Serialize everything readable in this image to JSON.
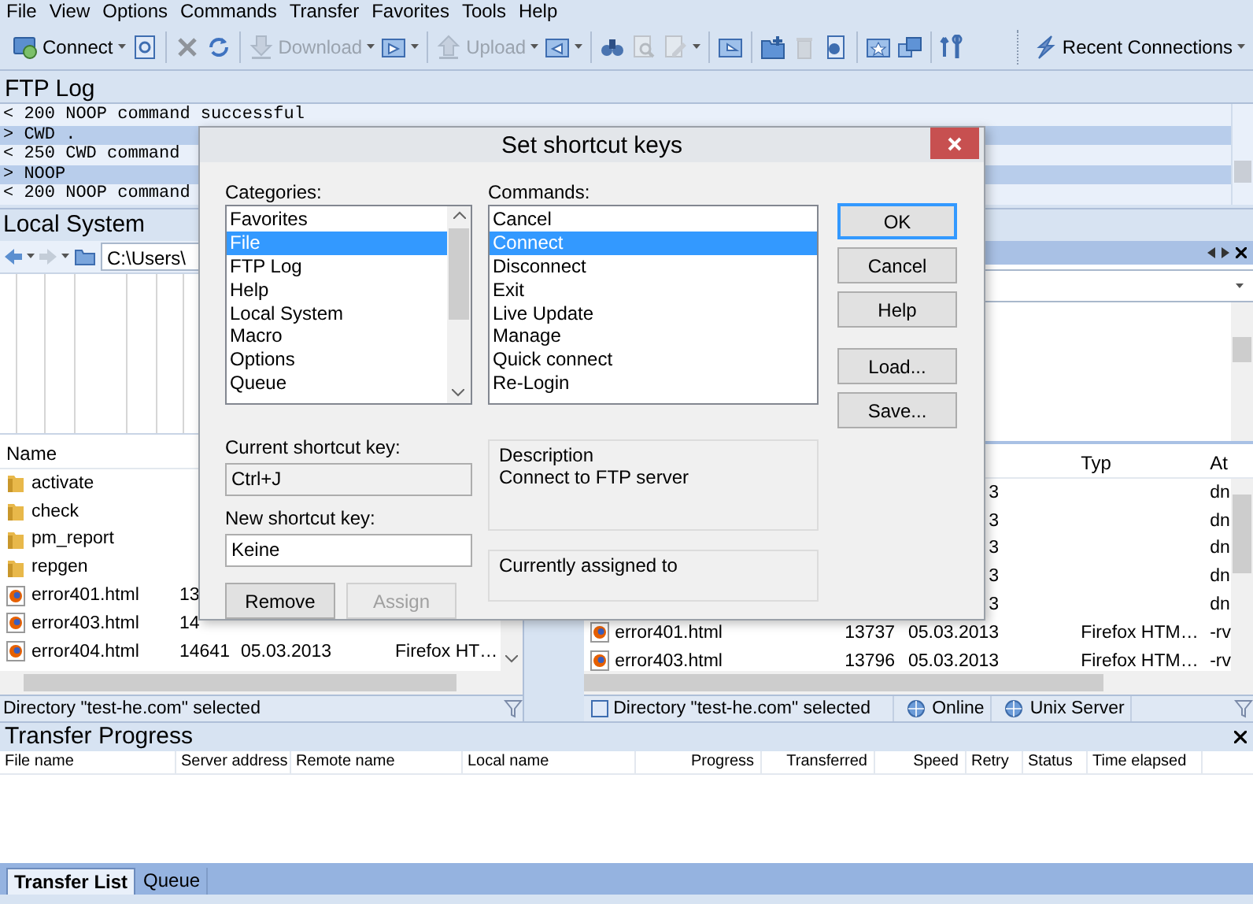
{
  "menu": [
    "File",
    "View",
    "Options",
    "Commands",
    "Transfer",
    "Favorites",
    "Tools",
    "Help"
  ],
  "toolbar": [
    {
      "kind": "labeled",
      "label": "Connect",
      "dropdown": true,
      "disabled": false
    },
    {
      "kind": "icon",
      "dropdown": false,
      "disabled": false
    },
    {
      "kind": "separator"
    },
    {
      "kind": "icon",
      "dropdown": false,
      "disabled": true
    },
    {
      "kind": "icon",
      "dropdown": false,
      "disabled": false
    },
    {
      "kind": "separator"
    },
    {
      "kind": "labeled",
      "label": "Download",
      "dropdown": true,
      "disabled": true
    },
    {
      "kind": "icon",
      "dropdown": true,
      "disabled": false
    },
    {
      "kind": "separator"
    },
    {
      "kind": "labeled",
      "label": "Upload",
      "dropdown": true,
      "disabled": true
    },
    {
      "kind": "icon",
      "dropdown": true,
      "disabled": false
    },
    {
      "kind": "separator"
    },
    {
      "kind": "icon",
      "dropdown": false,
      "disabled": false
    },
    {
      "kind": "icon",
      "dropdown": false,
      "disabled": true
    },
    {
      "kind": "icon",
      "dropdown": true,
      "disabled": true
    },
    {
      "kind": "separator"
    },
    {
      "kind": "icon",
      "dropdown": false,
      "disabled": false
    },
    {
      "kind": "separator"
    },
    {
      "kind": "icon",
      "dropdown": false,
      "disabled": false
    },
    {
      "kind": "icon",
      "dropdown": false,
      "disabled": true
    },
    {
      "kind": "icon",
      "dropdown": false,
      "disabled": false
    },
    {
      "kind": "separator"
    },
    {
      "kind": "icon",
      "dropdown": false,
      "disabled": false
    },
    {
      "kind": "icon",
      "dropdown": false,
      "disabled": false
    },
    {
      "kind": "separator"
    },
    {
      "kind": "icon",
      "dropdown": false,
      "disabled": false
    },
    {
      "kind": "separator"
    },
    {
      "kind": "labeled",
      "label": "Recent Connections",
      "dropdown": true,
      "disabled": false
    }
  ],
  "ftp_log": {
    "title": "FTP Log",
    "lines": [
      {
        "text": "< 200 NOOP command successful",
        "highlighted": false
      },
      {
        "text": "> CWD .",
        "highlighted": true
      },
      {
        "text": "< 250 CWD command",
        "highlighted": false
      },
      {
        "text": "> NOOP",
        "highlighted": true
      },
      {
        "text": "< 200 NOOP command",
        "highlighted": false
      }
    ]
  },
  "local_system": {
    "title": "Local System",
    "path": "C:\\Users\\",
    "columns": [
      "Name"
    ],
    "rows": [
      {
        "kind": "folder",
        "name": "activate"
      },
      {
        "kind": "folder",
        "name": "check"
      },
      {
        "kind": "folder",
        "name": "pm_report"
      },
      {
        "kind": "folder",
        "name": "repgen"
      },
      {
        "kind": "file",
        "name": "error401.html",
        "size": "13"
      },
      {
        "kind": "file",
        "name": "error403.html",
        "size": "14"
      },
      {
        "kind": "file",
        "name": "error404.html",
        "size": "14641",
        "date": "05.03.2013",
        "type": "Firefox HT…"
      }
    ],
    "status": "Directory \"test-he.com\" selected"
  },
  "remote_system": {
    "columns": [
      "Typ",
      "At"
    ],
    "rows": [
      {
        "date": "3",
        "attributes": "dn"
      },
      {
        "date": "3",
        "attributes": "dn"
      },
      {
        "date": "3",
        "attributes": "dn"
      },
      {
        "date": "3",
        "attributes": "dn"
      },
      {
        "date": "3",
        "attributes": "dn"
      },
      {
        "kind": "file",
        "name": "error401.html",
        "size": "13737",
        "date": "05.03.2013",
        "type": "Firefox HTM…",
        "attributes": "-rv"
      },
      {
        "kind": "file",
        "name": "error403.html",
        "size": "13796",
        "date": "05.03.2013",
        "type": "Firefox HTM…",
        "attributes": "-rv"
      }
    ],
    "status": [
      "Directory \"test-he.com\" selected",
      "Online",
      "Unix Server"
    ]
  },
  "transfer_progress": {
    "title": "Transfer Progress",
    "columns": [
      "File name",
      "Server address",
      "Remote name",
      "Local name",
      "Progress",
      "Transferred",
      "Speed",
      "Retry",
      "Status",
      "Time elapsed"
    ],
    "tabs": [
      {
        "label": "Transfer List",
        "selected": true
      },
      {
        "label": "Queue",
        "selected": false
      }
    ]
  },
  "dialog": {
    "title": "Set shortcut keys",
    "categories": {
      "label": "Categories:",
      "items": [
        {
          "text": "Favorites",
          "selected": false
        },
        {
          "text": "File",
          "selected": true
        },
        {
          "text": "FTP Log",
          "selected": false
        },
        {
          "text": "Help",
          "selected": false
        },
        {
          "text": "Local System",
          "selected": false
        },
        {
          "text": "Macro",
          "selected": false
        },
        {
          "text": "Options",
          "selected": false
        },
        {
          "text": "Queue",
          "selected": false
        }
      ]
    },
    "commands": {
      "label": "Commands:",
      "items": [
        {
          "text": "Cancel",
          "selected": false
        },
        {
          "text": "Connect",
          "selected": true
        },
        {
          "text": "Disconnect",
          "selected": false
        },
        {
          "text": "Exit",
          "selected": false
        },
        {
          "text": "Live Update",
          "selected": false
        },
        {
          "text": "Manage",
          "selected": false
        },
        {
          "text": "Quick connect",
          "selected": false
        },
        {
          "text": "Re-Login",
          "selected": false
        }
      ]
    },
    "buttons": [
      {
        "label": "OK",
        "default": true
      },
      {
        "label": "Cancel",
        "default": false
      },
      {
        "label": "Help",
        "default": false
      },
      {
        "label": "Load...",
        "default": false
      },
      {
        "label": "Save...",
        "default": false
      }
    ],
    "current_shortcut": {
      "label": "Current shortcut key:",
      "value": "Ctrl+J"
    },
    "new_shortcut": {
      "label": "New shortcut key:",
      "value": "Keine"
    },
    "actions": [
      {
        "label": "Remove",
        "disabled": false
      },
      {
        "label": "Assign",
        "disabled": true
      }
    ],
    "description": {
      "label": "Description",
      "text": "Connect to FTP server"
    },
    "assigned": {
      "label": "Currently assigned to"
    }
  }
}
